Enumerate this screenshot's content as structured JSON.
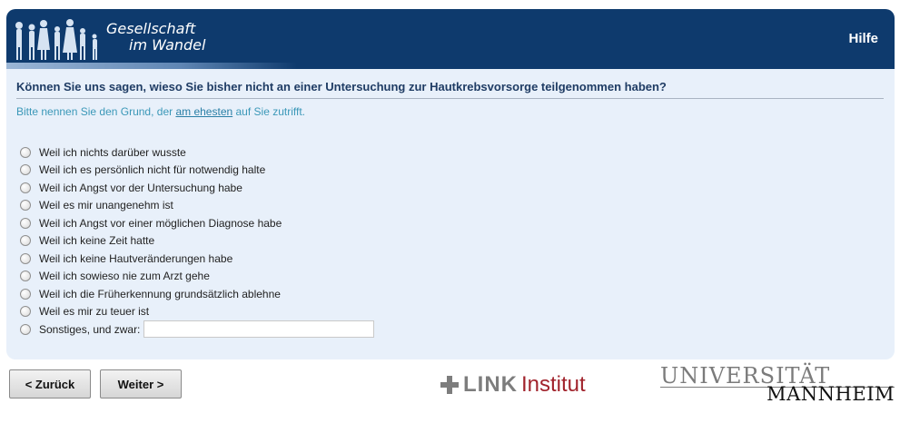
{
  "header": {
    "logo_line1": "Gesellschaft",
    "logo_line2": "im Wandel",
    "help_label": "Hilfe",
    "bg_color": "#0e3a6d"
  },
  "question": {
    "text": "Können Sie uns sagen, wieso Sie bisher nicht an einer Untersuchung zur Hautkrebsvorsorge teilgenommen haben?",
    "instruction_before": "Bitte nennen Sie den Grund, der ",
    "instruction_emph": "am ehesten",
    "instruction_after": " auf Sie zutrifft."
  },
  "options": [
    "Weil ich nichts darüber wusste",
    "Weil ich es persönlich nicht für notwendig halte",
    "Weil ich Angst vor der Untersuchung habe",
    "Weil es mir unangenehm ist",
    "Weil ich Angst vor einer möglichen Diagnose habe",
    "Weil ich keine Zeit hatte",
    "Weil ich keine Hautveränderungen habe",
    "Weil ich sowieso nie zum Arzt gehe",
    "Weil ich die Früherkennung grundsätzlich ablehne",
    "Weil es mir zu teuer ist"
  ],
  "other_option": {
    "label": "Sonstiges, und zwar:",
    "value": ""
  },
  "nav": {
    "back_label": "< Zurück",
    "next_label": "Weiter >"
  },
  "footer": {
    "link_bold": "LINK",
    "link_institut": "Institut",
    "uni_top": "UNIVERSITÄT",
    "uni_bottom": "MANNHEIM"
  }
}
